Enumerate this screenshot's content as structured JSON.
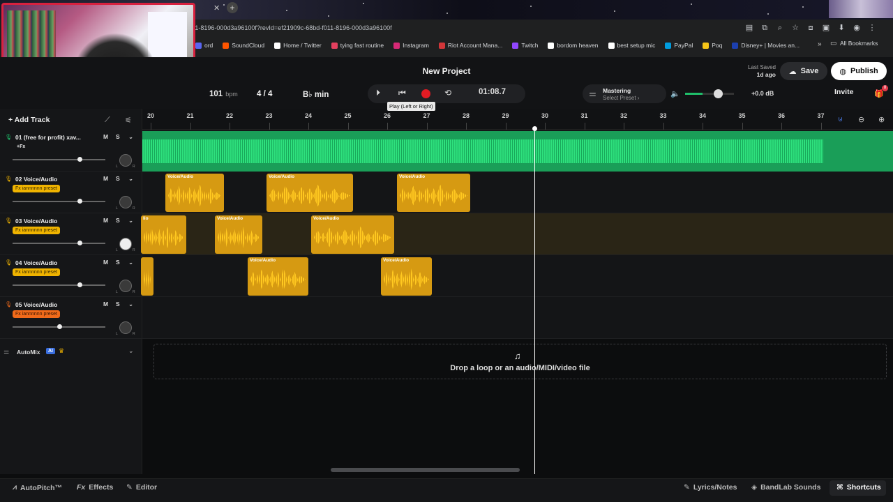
{
  "browser": {
    "url": "011-8196-000d3a96100f?revId=ef21909c-68bd-f011-8196-000d3a96100f",
    "bookmarks": [
      {
        "label": "ord",
        "color": "#5865f2"
      },
      {
        "label": "SoundCloud",
        "color": "#ff5500"
      },
      {
        "label": "Home / Twitter",
        "color": "#ffffff"
      },
      {
        "label": "tying fast routine",
        "color": "#e4405f"
      },
      {
        "label": "Instagram",
        "color": "#d62976"
      },
      {
        "label": "Riot Account Mana...",
        "color": "#d13639"
      },
      {
        "label": "Twitch",
        "color": "#9146ff"
      },
      {
        "label": "bordom heaven",
        "color": "#ffffff"
      },
      {
        "label": "best setup mic",
        "color": "#ffffff"
      },
      {
        "label": "PayPal",
        "color": "#009cde"
      },
      {
        "label": "Poq",
        "color": "#f5c518"
      },
      {
        "label": "Disney+ | Movies an...",
        "color": "#1c3fae"
      }
    ],
    "all_bookmarks": "All Bookmarks"
  },
  "header": {
    "project_title": "New Project",
    "last_saved_label": "Last Saved",
    "last_saved_value": "1d ago",
    "save": "Save",
    "publish": "Publish",
    "invite": "Invite",
    "invite_badge": "8"
  },
  "transport": {
    "bpm_value": "101",
    "bpm_unit": "bpm",
    "time_sig": "4 / 4",
    "key": "B♭ min",
    "time": "01:08.7",
    "tooltip": "Play (Left or Right)"
  },
  "mastering": {
    "title": "Mastering",
    "preset": "Select Preset ›",
    "volume_db": "+0.0 dB",
    "volume_level": 0.7
  },
  "toolbar": {
    "add_track": "Add Track"
  },
  "ruler": {
    "bars": [
      "20",
      "21",
      "22",
      "23",
      "24",
      "25",
      "26",
      "27",
      "28",
      "29",
      "30",
      "31",
      "32",
      "33",
      "34",
      "35",
      "36",
      "37"
    ]
  },
  "tracks": [
    {
      "name": "01 (free for profit) xav...",
      "fx": "+Fx",
      "color": "#1fbf6a",
      "volume": 0.72
    },
    {
      "name": "02 Voice/Audio",
      "fx": "Fx iannnnnn preset",
      "color": "#f0b400",
      "volume": 0.72
    },
    {
      "name": "03 Voice/Audio",
      "fx": "Fx iannnnnn preset",
      "color": "#f0b400",
      "volume": 0.72
    },
    {
      "name": "04 Voice/Audio",
      "fx": "Fx iannnnnn preset",
      "color": "#f0b400",
      "volume": 0.72
    },
    {
      "name": "05 Voice/Audio",
      "fx": "Fx iannnnnn preset",
      "color": "#f06a1a",
      "volume": 0.5
    }
  ],
  "clips": {
    "label": "Voice/Audio",
    "partial_label": "lio"
  },
  "mute": "M",
  "solo": "S",
  "pan_left": "L",
  "pan_right": "R",
  "automix": {
    "label": "AutoMix",
    "ai_badge": "AI"
  },
  "drop_zone": "Drop a loop or an audio/MIDI/video file",
  "bottom": {
    "autopitch": "AutoPitch™",
    "effects": "Effects",
    "editor": "Editor",
    "lyrics": "Lyrics/Notes",
    "sounds": "BandLab Sounds",
    "shortcuts": "Shortcuts"
  }
}
